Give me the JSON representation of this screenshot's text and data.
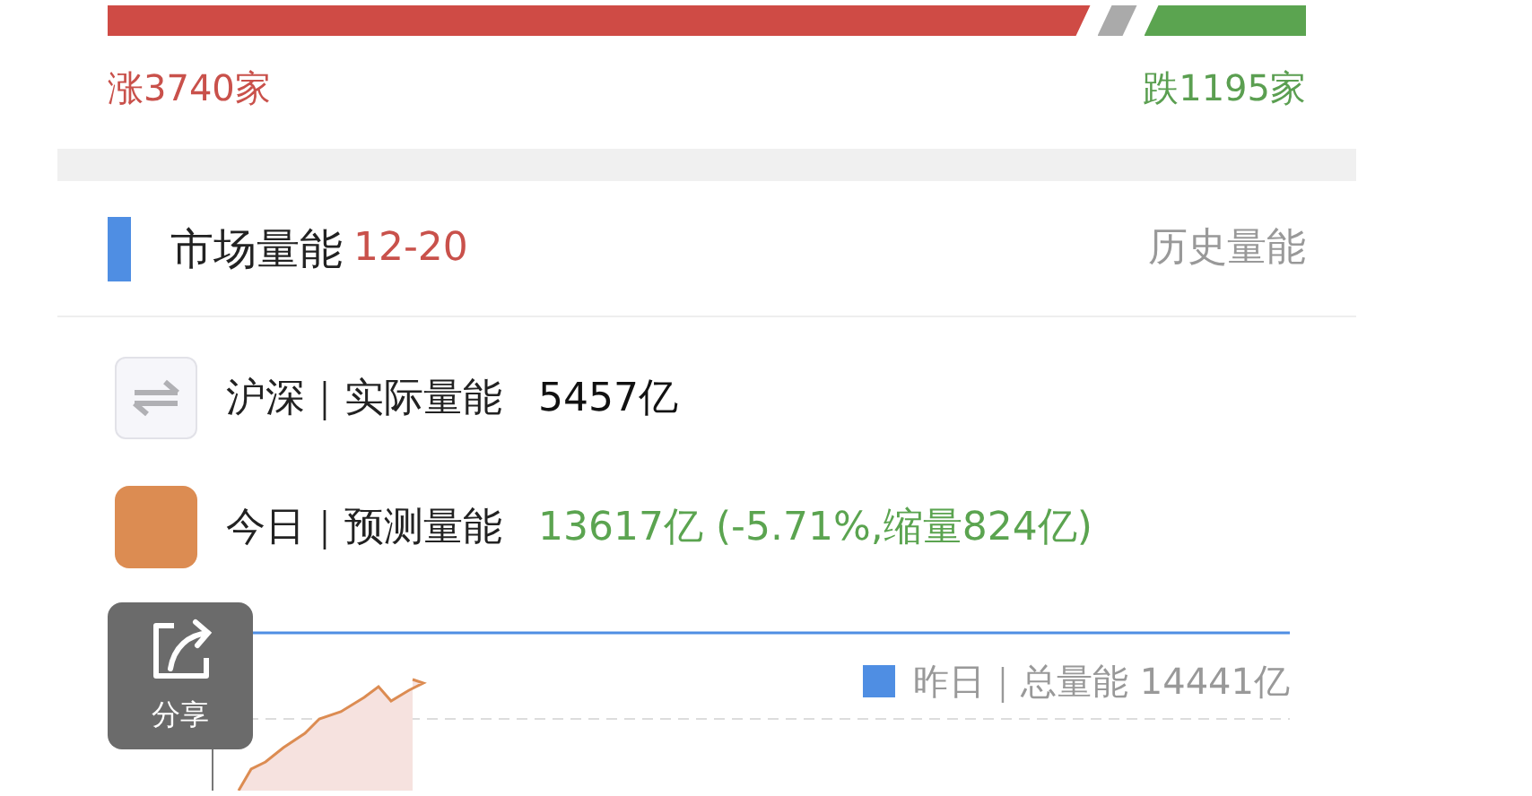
{
  "breadth_bar": {
    "level": 0.82
  },
  "rise_label": "涨3740家",
  "fall_label": "跌1195家",
  "section": {
    "title": "市场量能",
    "date": "12-20",
    "link": "历史量能"
  },
  "rows": [
    {
      "kind": "actual",
      "label": "沪深｜实际量能",
      "value": "5457亿"
    },
    {
      "kind": "forecast",
      "label": "今日｜预测量能",
      "value": "13617亿 (-5.71%,缩量824亿)"
    }
  ],
  "legend": "昨日｜总量能 14441亿",
  "share": {
    "label": "分享"
  }
}
